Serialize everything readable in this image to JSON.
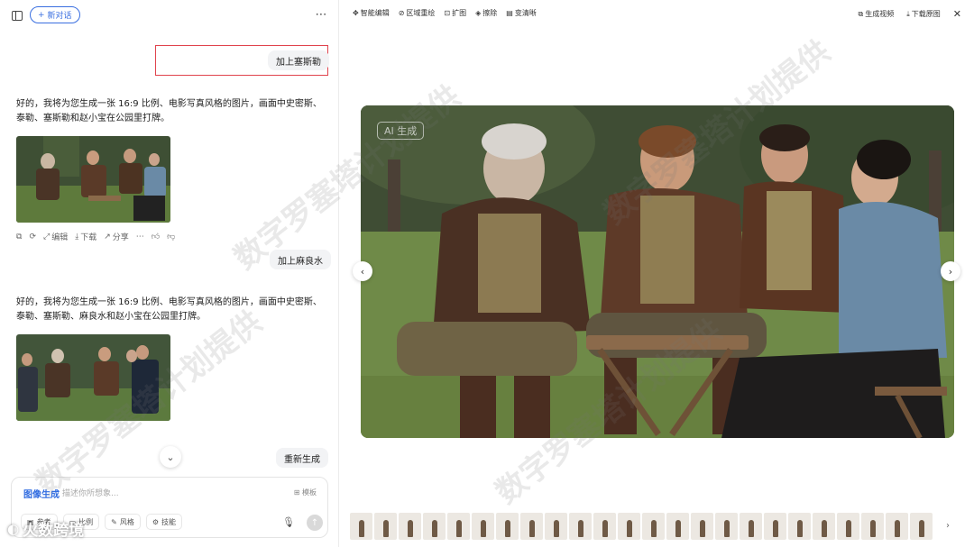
{
  "sidebar": {
    "new_chat_label": "新对话",
    "more_icon": "more-icon"
  },
  "chat": {
    "user_msg_1": "加上塞斯勒",
    "ai_msg_1": "好的，我将为您生成一张 16:9 比例、电影写真风格的图片，画面中史密斯、泰勒、塞斯勒和赵小宝在公园里打牌。",
    "actions": {
      "edit": "编辑",
      "download": "下载",
      "share": "分享"
    },
    "user_msg_2": "加上麻良水",
    "ai_msg_2": "好的，我将为您生成一张 16:9 比例、电影写真风格的图片，画面中史密斯、泰勒、塞斯勒、麻良水和赵小宝在公园里打牌。",
    "regenerate": "重新生成"
  },
  "input": {
    "mode": "图像生成",
    "placeholder": "描述你所想象...",
    "model_label": "模板",
    "chips": [
      "参考",
      "比例",
      "风格",
      "技能"
    ]
  },
  "brand_label": "火数跨境",
  "toolbar": {
    "left": [
      "智能编辑",
      "区域重绘",
      "扩图",
      "擦除",
      "变清晰"
    ],
    "right": [
      "生成视频",
      "下载原图"
    ]
  },
  "image": {
    "ai_badge": "AI 生成"
  },
  "watermark": "数字罗塞塔计划提供",
  "colors": {
    "accent": "#2f6be0",
    "highlight": "#e0434d"
  }
}
